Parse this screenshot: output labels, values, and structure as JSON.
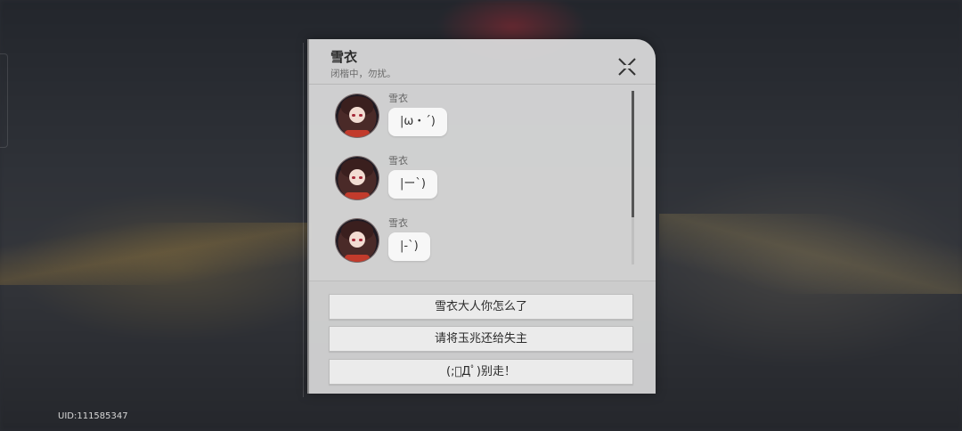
{
  "dialog": {
    "title": "雪衣",
    "subtitle": "闭楷中，勿扰。"
  },
  "messages": [
    {
      "sender": "雪衣",
      "text": "|ω・´)"
    },
    {
      "sender": "雪衣",
      "text": "|ー`)"
    },
    {
      "sender": "雪衣",
      "text": "|-`)"
    }
  ],
  "options": [
    {
      "label": "雪衣大人你怎么了"
    },
    {
      "label": "请将玉兆还给失主"
    },
    {
      "label": "(;ﾟДﾟ)别走！"
    }
  ],
  "footer": {
    "uid": "UID:111585347"
  },
  "icons": {
    "close": "close-x-icon",
    "avatar": "character-avatar"
  }
}
